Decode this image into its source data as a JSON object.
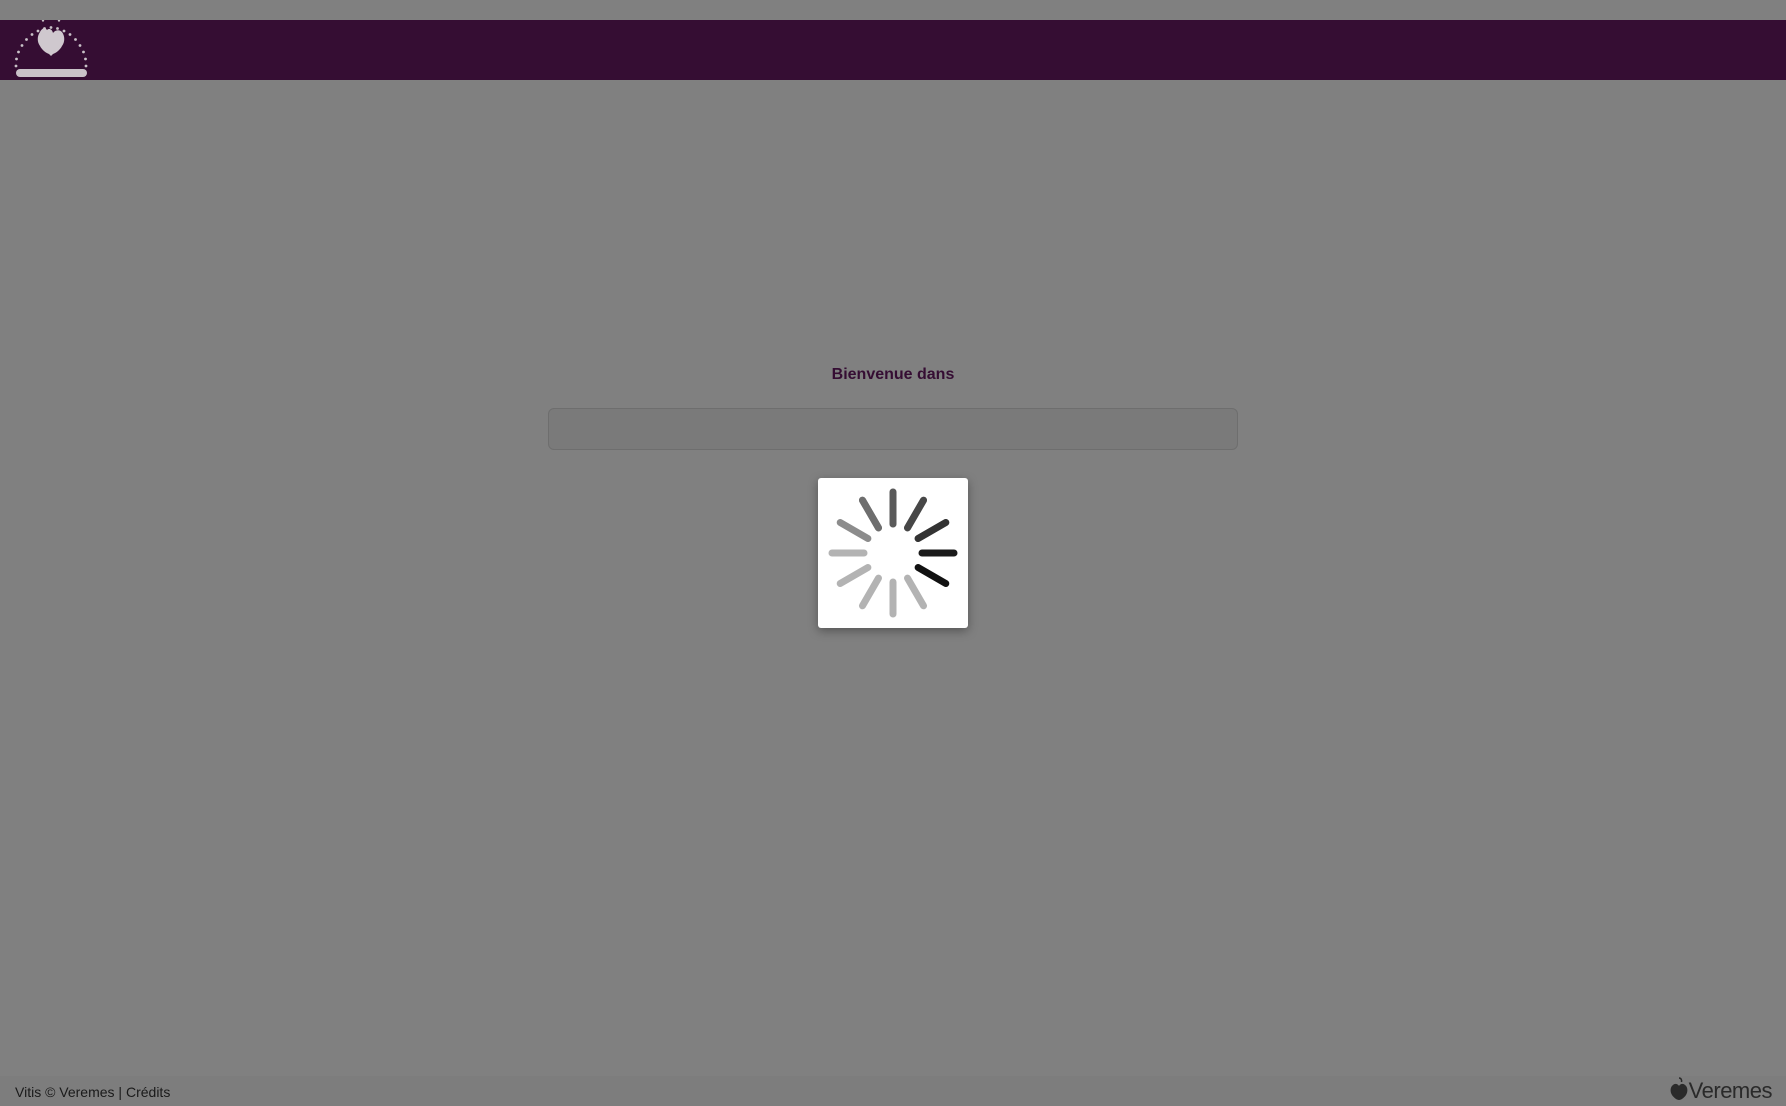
{
  "header": {
    "logo_icon": "vitis-logo-icon",
    "background_color": "#350d33"
  },
  "main": {
    "welcome_text": "Bienvenue dans",
    "app_select_value": ""
  },
  "loader": {
    "icon": "spinner-icon"
  },
  "footer": {
    "copyright_text": "Vitis © Veremes",
    "separator": " | ",
    "credits_link": "Crédits",
    "brand_logo_icon": "veremes-logo-icon",
    "brand_name": "Veremes"
  },
  "colors": {
    "overlay": "#808080",
    "accent": "#350d33"
  }
}
